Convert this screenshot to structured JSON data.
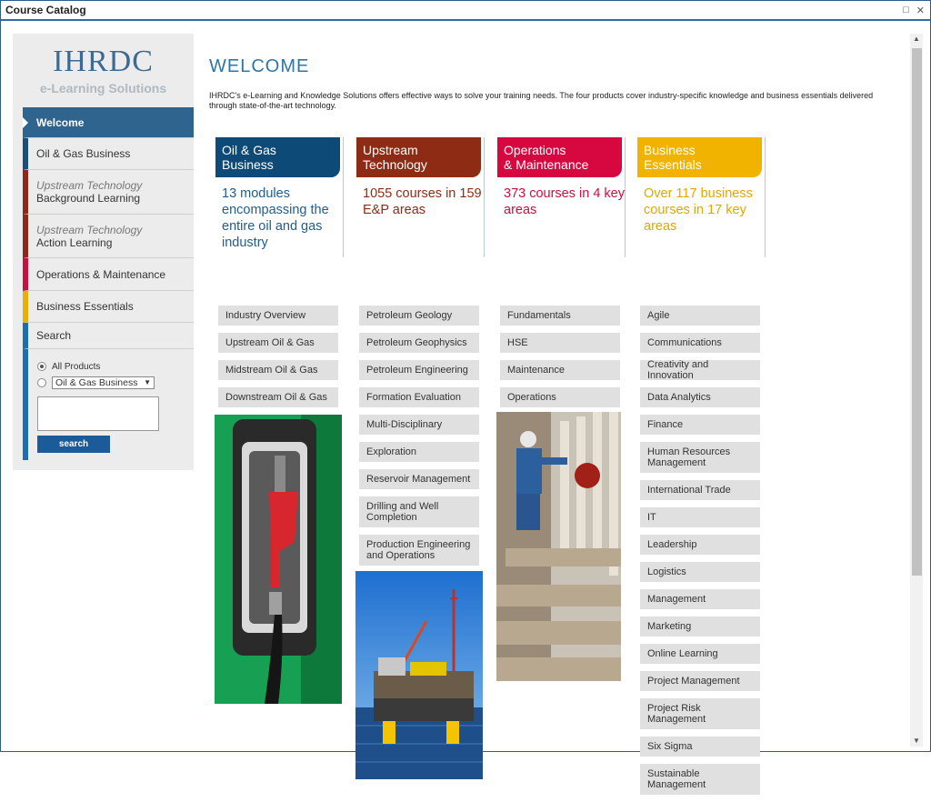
{
  "window": {
    "title": "Course Catalog"
  },
  "sidebar": {
    "logo_title": "IHRDC",
    "logo_subtitle": "e-Learning Solutions",
    "nav": [
      {
        "label": "Welcome",
        "sub": "",
        "color": "#2f648f"
      },
      {
        "label": "Oil & Gas Business",
        "sub": "",
        "color": "#1a4f7a"
      },
      {
        "label": "Background Learning",
        "sub": "Upstream Technology",
        "color": "#8b2a1a"
      },
      {
        "label": "Action Learning",
        "sub": "Upstream Technology",
        "color": "#8b2a1a"
      },
      {
        "label": "Operations & Maintenance",
        "sub": "",
        "color": "#c8103e"
      },
      {
        "label": "Business Essentials",
        "sub": "",
        "color": "#e7b007"
      }
    ],
    "search": {
      "heading": "Search",
      "option_all": "All Products",
      "option_select": "Oil & Gas Business",
      "button": "search"
    }
  },
  "main": {
    "heading": "WELCOME",
    "intro": "IHRDC's e-Learning and Knowledge Solutions offers effective ways to solve your training needs. The four products cover industry-specific knowledge and business essentials delivered through state-of-the-art technology.",
    "columns": [
      {
        "title_line1": "Oil & Gas",
        "title_line2": "Business",
        "color": "#0e4a78",
        "desc_color": "#1f5d8e",
        "desc": "13 modules encompassing the entire oil and gas industry",
        "links": [
          "Industry Overview",
          "Upstream Oil & Gas",
          "Midstream Oil & Gas",
          "Downstream Oil & Gas"
        ]
      },
      {
        "title_line1": "Upstream",
        "title_line2": "Technology",
        "color": "#8e2b14",
        "desc_color": "#8e2b14",
        "desc": "1055 courses in 159 E&P areas",
        "links": [
          "Petroleum Geology",
          "Petroleum Geophysics",
          "Petroleum Engineering",
          "Formation Evaluation",
          "Multi-Disciplinary",
          "Exploration",
          "Reservoir Management",
          "Drilling and Well Completion",
          "Production Engineering and Operations"
        ]
      },
      {
        "title_line1": "Operations",
        "title_line2": "& Maintenance",
        "color": "#d7083f",
        "desc_color": "#c8103e",
        "desc": "373 courses in 4 key areas",
        "links": [
          "Fundamentals",
          "HSE",
          "Maintenance",
          "Operations"
        ]
      },
      {
        "title_line1": "Business",
        "title_line2": "Essentials",
        "color": "#f1b300",
        "desc_color": "#e3a600",
        "desc": "Over 117 business courses in 17 key areas",
        "links": [
          "Agile",
          "Communications",
          "Creativity and Innovation",
          "Data Analytics",
          "Finance",
          "Human Resources Management",
          "International Trade",
          "IT",
          "Leadership",
          "Logistics",
          "Management",
          "Marketing",
          "Online Learning",
          "Project Management",
          "Project Risk Management",
          "Six Sigma",
          "Sustainable Management"
        ]
      }
    ]
  }
}
